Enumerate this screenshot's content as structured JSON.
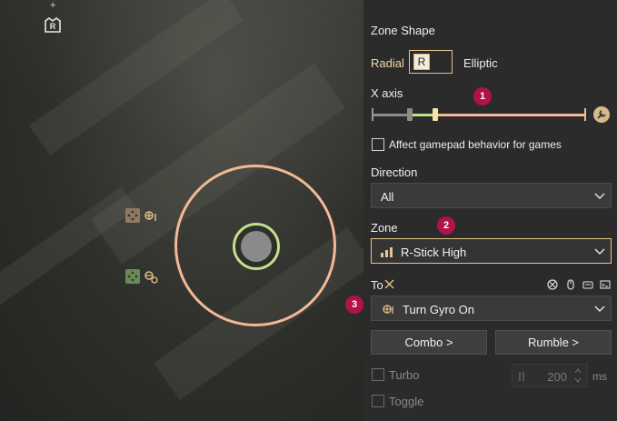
{
  "colors": {
    "accent": "#e5c48a",
    "outer_ring": "#f2b994",
    "inner_ring": "#c3df8e",
    "badge": "#b0124a",
    "panel_bg": "#2b2b2b"
  },
  "game_view": {
    "icons": [
      "r-stick-badge-icon",
      "plus-icon",
      "move-dpad-icon",
      "gyro-icon",
      "gyro-off-icon"
    ]
  },
  "panel": {
    "zone_shape_label": "Zone Shape",
    "radial_label": "Radial",
    "shape_key": "R",
    "elliptic_label": "Elliptic",
    "x_axis_label": "X axis",
    "badges": [
      "1",
      "2",
      "3"
    ],
    "affect_gamepad_label": "Affect gamepad behavior for games",
    "direction_label": "Direction",
    "direction_value": "All",
    "zone_label": "Zone",
    "zone_value": "R-Stick High",
    "to_label": "To",
    "action_value": "Turn Gyro On",
    "combo_label": "Combo >",
    "rumble_label": "Rumble >",
    "turbo_label": "Turbo",
    "turbo_value": "200",
    "turbo_unit": "ms",
    "toggle_label": "Toggle"
  }
}
